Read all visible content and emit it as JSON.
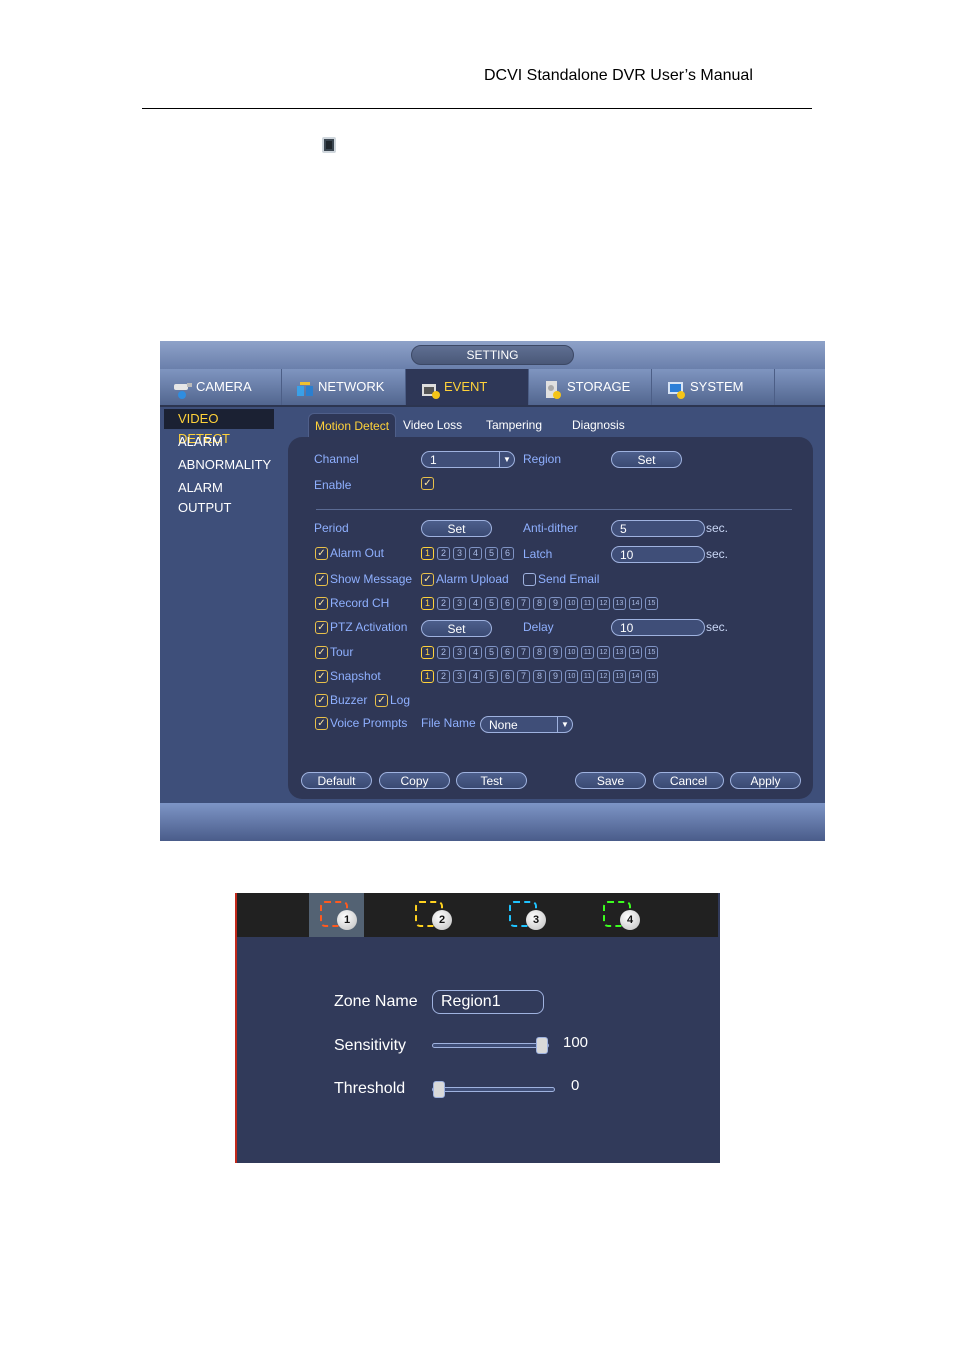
{
  "document": {
    "header_title": "DCVI Standalone DVR User’s Manual",
    "inline_icon": "region-square-icon"
  },
  "dvr": {
    "title": "SETTING",
    "nav": [
      {
        "label": "CAMERA",
        "icon": "camera-icon",
        "active": false
      },
      {
        "label": "NETWORK",
        "icon": "network-icon",
        "active": false
      },
      {
        "label": "EVENT",
        "icon": "event-icon",
        "active": true
      },
      {
        "label": "STORAGE",
        "icon": "storage-icon",
        "active": false
      },
      {
        "label": "SYSTEM",
        "icon": "system-icon",
        "active": false
      }
    ],
    "sidebar": [
      {
        "label": "VIDEO DETECT",
        "active": true
      },
      {
        "label": "ALARM",
        "active": false
      },
      {
        "label": "ABNORMALITY",
        "active": false
      },
      {
        "label": "ALARM OUTPUT",
        "active": false
      }
    ],
    "subtabs": [
      {
        "label": "Motion Detect",
        "active": true
      },
      {
        "label": "Video Loss",
        "active": false
      },
      {
        "label": "Tampering",
        "active": false
      },
      {
        "label": "Diagnosis",
        "active": false
      }
    ],
    "form": {
      "channel_label": "Channel",
      "channel_value": "1",
      "region_label": "Region",
      "region_button": "Set",
      "enable_label": "Enable",
      "enable_checked": true,
      "period_label": "Period",
      "period_button": "Set",
      "antidither_label": "Anti-dither",
      "antidither_value": "5",
      "antidither_unit": "sec.",
      "alarm_out_label": "Alarm Out",
      "alarm_out_checked": true,
      "alarm_out_channels": [
        "1",
        "2",
        "3",
        "4",
        "5",
        "6"
      ],
      "alarm_out_selected": [
        "1"
      ],
      "latch_label": "Latch",
      "latch_value": "10",
      "latch_unit": "sec.",
      "show_message_label": "Show Message",
      "show_message_checked": true,
      "alarm_upload_label": "Alarm Upload",
      "alarm_upload_checked": true,
      "send_email_label": "Send Email",
      "send_email_checked": false,
      "record_ch_label": "Record CH",
      "record_ch_checked": true,
      "channels15": [
        "1",
        "2",
        "3",
        "4",
        "5",
        "6",
        "7",
        "8",
        "9",
        "10",
        "11",
        "12",
        "13",
        "14",
        "15"
      ],
      "record_ch_selected": [
        "1"
      ],
      "ptz_label": "PTZ Activation",
      "ptz_checked": true,
      "ptz_button": "Set",
      "delay_label": "Delay",
      "delay_value": "10",
      "delay_unit": "sec.",
      "tour_label": "Tour",
      "tour_checked": true,
      "tour_selected": [
        "1"
      ],
      "snapshot_label": "Snapshot",
      "snapshot_checked": true,
      "snapshot_selected": [
        "1"
      ],
      "buzzer_label": "Buzzer",
      "buzzer_checked": true,
      "log_label": "Log",
      "log_checked": true,
      "voice_label": "Voice Prompts",
      "voice_checked": true,
      "file_name_label": "File Name",
      "file_name_value": "None"
    },
    "buttons": {
      "default": "Default",
      "copy": "Copy",
      "test": "Test",
      "save": "Save",
      "cancel": "Cancel",
      "apply": "Apply"
    }
  },
  "region_dialog": {
    "zones": [
      {
        "number": "1",
        "color": "#ff5a1f",
        "selected": true
      },
      {
        "number": "2",
        "color": "#ffd21f",
        "selected": false
      },
      {
        "number": "3",
        "color": "#1fc3ff",
        "selected": false
      },
      {
        "number": "4",
        "color": "#3cff1f",
        "selected": false
      }
    ],
    "zone_name_label": "Zone Name",
    "zone_name_value": "Region1",
    "sensitivity_label": "Sensitivity",
    "sensitivity_value": "100",
    "sensitivity_fraction": 1.0,
    "threshold_label": "Threshold",
    "threshold_value": "0",
    "threshold_fraction": 0.0
  }
}
